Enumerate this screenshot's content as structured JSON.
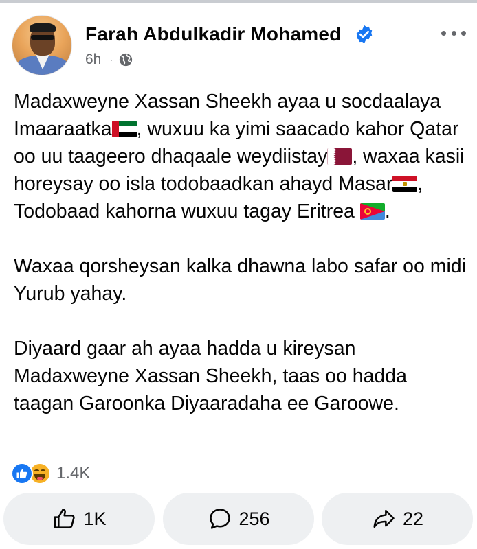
{
  "post": {
    "author": "Farah Abdulkadir Mohamed",
    "time": "6h",
    "separator": "·",
    "paragraphs": [
      {
        "segments": [
          "Madaxweyne Xassan Sheekh ayaa u socdaalaya Imaaraatka",
          ", wuxuu ka yimi saacado kahor Qatar oo uu taageero dhaqaale weydiistay",
          ", waxaa kasii horeysay oo isla todobaadkan ahayd Masar",
          ", Todobaad kahorna wuxuu tagay Eritrea ",
          "."
        ]
      },
      {
        "text": "Waxaa qorsheysan kalka dhawna labo safar oo midi Yurub yahay."
      },
      {
        "text": "Diyaard gaar ah ayaa hadda u kireysan Madaxweyne Xassan Sheekh, taas oo hadda taagan Garoonka Diyaaradaha ee Garoowe."
      }
    ],
    "flags": [
      "uae-flag-icon",
      "qatar-flag-icon",
      "egypt-flag-icon",
      "eritrea-flag-icon"
    ],
    "reactions": {
      "icons": [
        "like-reaction-icon",
        "haha-reaction-icon"
      ],
      "count": "1.4K"
    },
    "actions": {
      "like": "1K",
      "comment": "256",
      "share": "22"
    }
  },
  "colors": {
    "brand_blue": "#1877f2",
    "secondary_text": "#65676b",
    "button_bg": "#eef0f2"
  }
}
